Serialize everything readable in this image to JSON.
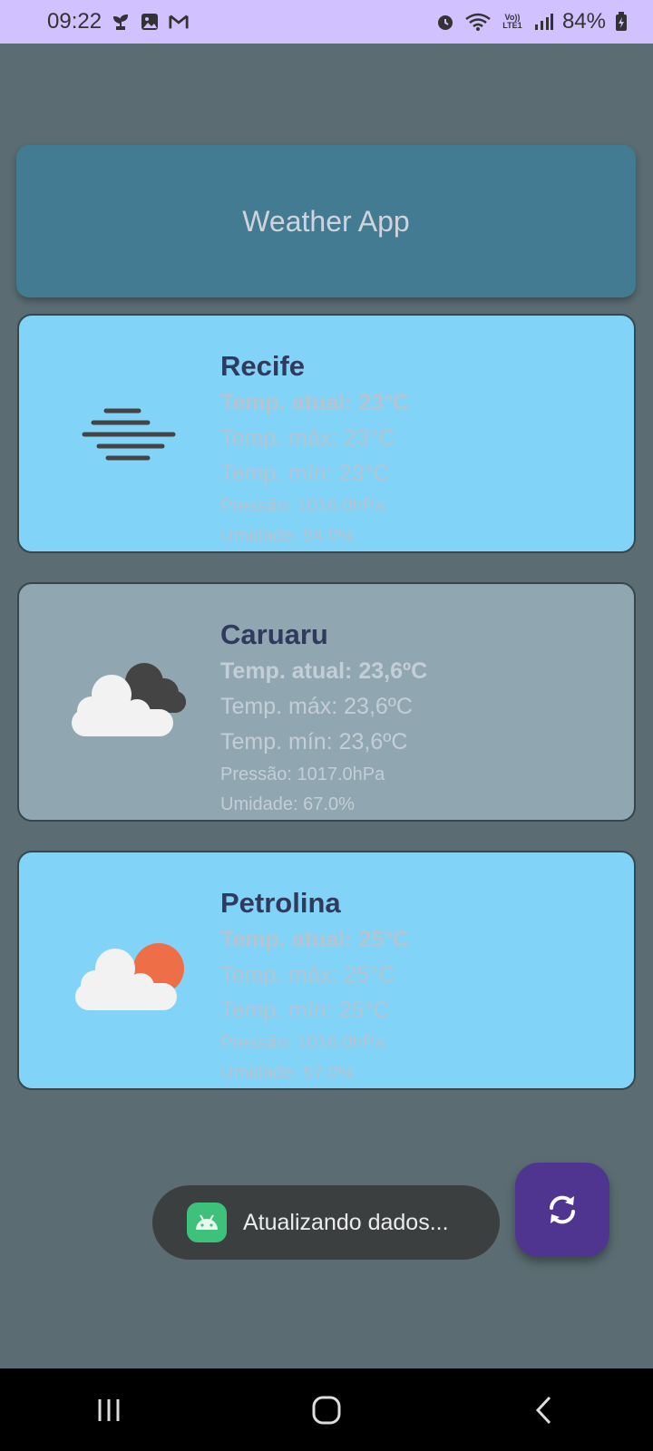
{
  "status_bar": {
    "time": "09:22",
    "battery": "84%",
    "icons": [
      "plant-icon",
      "gallery-icon",
      "gmail-icon",
      "alarm-icon",
      "wifi-icon",
      "volte-icon",
      "signal-icon",
      "battery-charging-icon"
    ]
  },
  "header": {
    "title": "Weather App"
  },
  "cards": [
    {
      "city": "Recife",
      "icon": "fog-icon",
      "temp_now": "Temp. atual: 23°C",
      "temp_max": "Temp. máx: 23°C",
      "temp_min": "Temp. mín: 23°C",
      "pressure": "Pressão: 1016.0hPa",
      "humidity": "Umidade: 94.0%",
      "bg": "#82d3f8",
      "text_color": "#b4c4d0"
    },
    {
      "city": "Caruaru",
      "icon": "broken-clouds-icon",
      "temp_now": "Temp. atual: 23,6ºC",
      "temp_max": "Temp. máx: 23,6ºC",
      "temp_min": "Temp. mín: 23,6ºC",
      "pressure": "Pressão: 1017.0hPa",
      "humidity": "Umidade: 67.0%",
      "bg": "#90a7b1",
      "text_color": "#c4ced6"
    },
    {
      "city": "Petrolina",
      "icon": "partly-cloudy-icon",
      "temp_now": "Temp. atual: 25°C",
      "temp_max": "Temp. máx: 25°C",
      "temp_min": "Temp. mín: 25°C",
      "pressure": "Pressão: 1016.0hPa",
      "humidity": "Umidade: 57.0%",
      "bg": "#82d3f8",
      "text_color": "#b4c4d0"
    }
  ],
  "toast": {
    "text": "Atualizando dados...",
    "icon": "android-icon"
  },
  "fab": {
    "icon": "refresh-icon"
  },
  "nav": {
    "icons": [
      "recents-icon",
      "home-icon",
      "back-icon"
    ]
  }
}
